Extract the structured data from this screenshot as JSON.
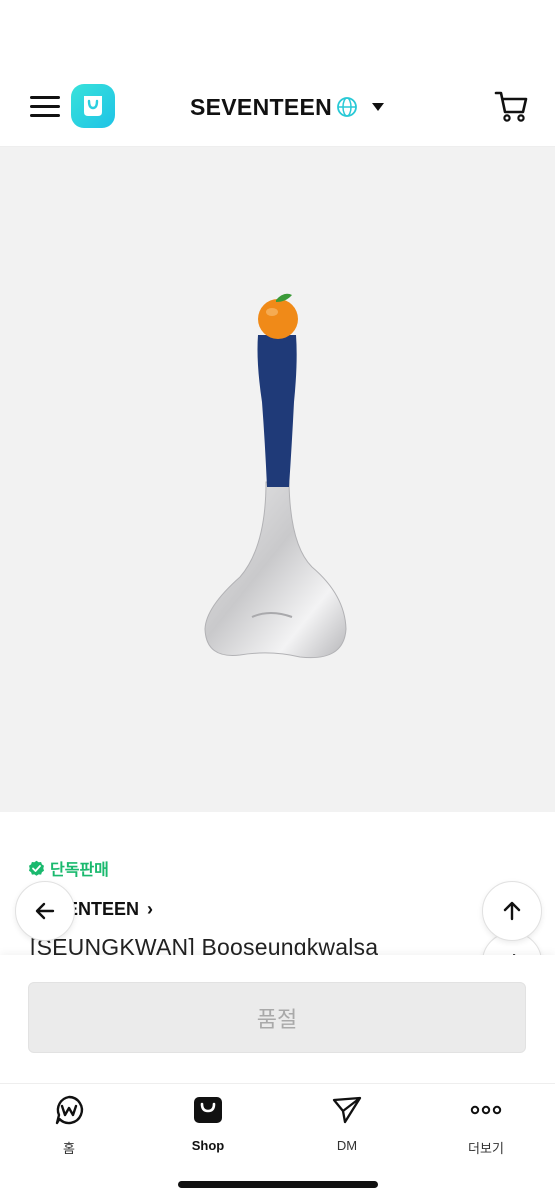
{
  "header": {
    "artist_name": "SEVENTEEN"
  },
  "product": {
    "exclusive_label": "단독판매",
    "artist_link": "SEVENTEEN",
    "title": "[SEUNGKWAN] Booseungkwalsa"
  },
  "actions": {
    "soldout_label": "품절"
  },
  "nav": {
    "home": "홈",
    "shop": "Shop",
    "dm": "DM",
    "more": "더보기"
  },
  "colors": {
    "brand_teal": "#29d3e0",
    "exclusive_green": "#1ab96e",
    "soldout_bg": "#ebebeb"
  }
}
